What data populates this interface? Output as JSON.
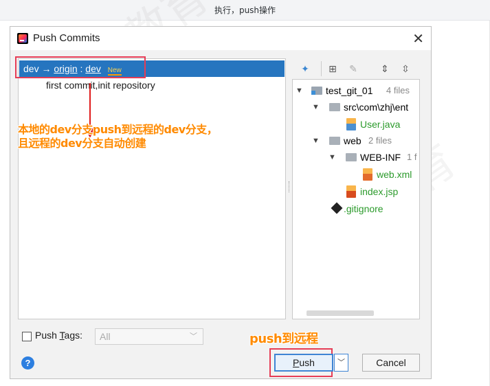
{
  "caption": "执行，push操作",
  "dialog": {
    "title": "Push Commits",
    "close_glyph": "✕"
  },
  "commits": {
    "branch_local": "dev",
    "arrow": "→",
    "remote": "origin",
    "separator": ":",
    "branch_remote": "dev",
    "new_badge": "New",
    "commit_message": "first commit,init repository"
  },
  "annotations": {
    "branch_note_line1": "本地的dev分支push到远程的dev分支，",
    "branch_note_line2": "且远程的dev分支自动创建",
    "push_note": "push到远程"
  },
  "toolbar": {
    "icons": [
      "expand-diff-icon",
      "group-by-icon",
      "edit-icon",
      "expand-all-icon",
      "collapse-all-icon"
    ]
  },
  "file_tree": [
    {
      "name": "test_git_01",
      "meta": "4 files",
      "type": "module",
      "expanded": true
    },
    {
      "name": "src\\com\\zhj\\ent",
      "meta": "",
      "type": "folder",
      "expanded": true
    },
    {
      "name": "User.java",
      "meta": "",
      "type": "java"
    },
    {
      "name": "web",
      "meta": "2 files",
      "type": "folder",
      "expanded": true
    },
    {
      "name": "WEB-INF",
      "meta": "1 f",
      "type": "folder",
      "expanded": true
    },
    {
      "name": "web.xml",
      "meta": "",
      "type": "xml"
    },
    {
      "name": "index.jsp",
      "meta": "",
      "type": "jsp"
    },
    {
      "name": ".gitignore",
      "meta": "",
      "type": "git"
    }
  ],
  "footer": {
    "push_tags_prefix": "Push ",
    "push_tags_mnemonic": "T",
    "push_tags_suffix": "ags:",
    "tags_combo_value": "All",
    "help_glyph": "?",
    "push_mnemonic": "P",
    "push_rest": "ush",
    "cancel_label": "Cancel"
  },
  "colors": {
    "selection": "#2675bf",
    "annotation_red": "#e63c55",
    "annotation_orange": "#ff8a00",
    "added_file_green": "#2b9a2b",
    "push_border": "#3e84d4"
  }
}
